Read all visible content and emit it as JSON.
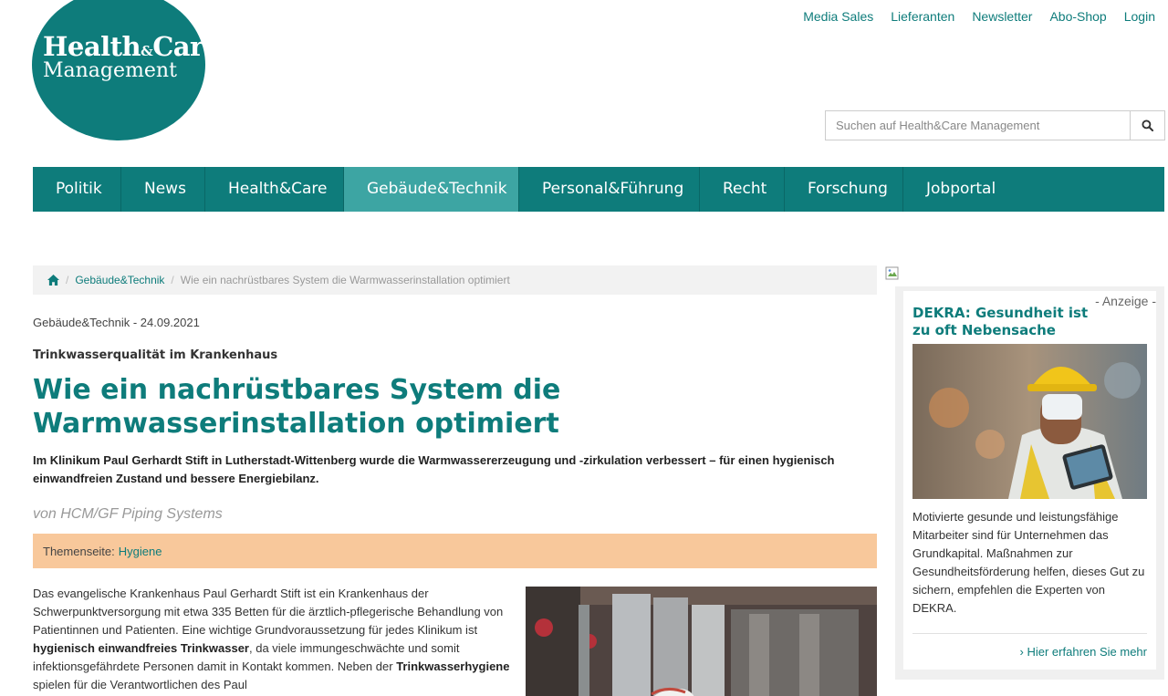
{
  "logo": {
    "line1a": "Health",
    "line1amp": "&",
    "line1b": "Care",
    "line2": "Management"
  },
  "toplinks": [
    "Media Sales",
    "Lieferanten",
    "Newsletter",
    "Abo-Shop",
    "Login"
  ],
  "search": {
    "placeholder": "Suchen auf Health&Care Management"
  },
  "nav": [
    "Politik",
    "News",
    "Health&Care",
    "Gebäude&Technik",
    "Personal&Führung",
    "Recht",
    "Forschung",
    "Jobportal"
  ],
  "breadcrumb": {
    "section": "Gebäude&Technik",
    "current": "Wie ein nachrüstbares System die Warmwasserinstallation optimiert"
  },
  "article": {
    "meta": "Gebäude&Technik - 24.09.2021",
    "kicker": "Trinkwasserqualität im Krankenhaus",
    "headline": "Wie ein nachrüstbares System die Warmwasserinstallation optimiert",
    "lead": "Im Klinikum Paul Gerhardt Stift in Lutherstadt-Wittenberg wurde die Warmwassererzeugung und -zirkulation verbessert – für einen hygienisch einwandfreien Zustand und bessere Energiebilanz.",
    "author": "von HCM/GF Piping Systems",
    "topic_label": "Themenseite:",
    "topic_link": "Hygiene",
    "body": {
      "p1": "Das evangelische Krankenhaus Paul Gerhardt Stift ist ein Krankenhaus der Schwerpunktversorgung mit etwa 335 Betten für die ärztlich-pflegerische Behandlung von Patientinnen und Patienten. Eine wichtige Grundvoraussetzung für jedes Klinikum ist ",
      "b1": "hygienisch einwandfreies Trinkwasser",
      "p2": ", da viele immungeschwächte und somit infektionsgefährdete Personen damit in Kontakt kommen. Neben der ",
      "b2": "Trinkwasserhygiene",
      "p3": " spielen für die Verantwortlichen des Paul"
    }
  },
  "ad": {
    "label": "- Anzeige -",
    "title": "DEKRA: Gesundheit ist zu oft Nebensache",
    "text": "Motivierte gesunde und leistungsfähige Mitarbeiter sind für Unternehmen das Grundkapital. Maßnahmen zur Gesundheitsförderung helfen, dieses Gut zu sichern, empfehlen die Experten von DEKRA.",
    "more": "› Hier erfahren Sie mehr"
  },
  "colors": {
    "brand": "#0e7c7b",
    "nav_active": "#3da5a3",
    "topic_bar": "#f8c89b"
  },
  "icons": [
    "home-icon",
    "search-icon",
    "broken-image-icon"
  ]
}
